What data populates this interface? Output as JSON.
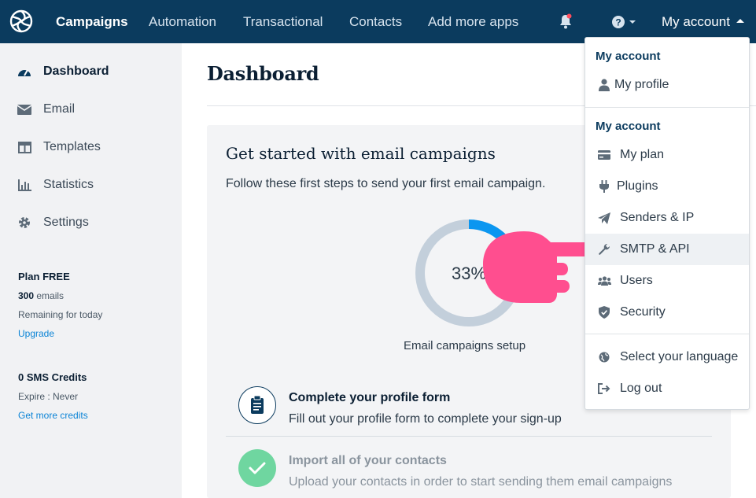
{
  "nav": {
    "items": [
      "Campaigns",
      "Automation",
      "Transactional",
      "Contacts",
      "Add more apps"
    ],
    "account_label": "My account"
  },
  "sidebar": {
    "items": [
      {
        "label": "Dashboard",
        "icon": "dashboard-icon"
      },
      {
        "label": "Email",
        "icon": "envelope-icon"
      },
      {
        "label": "Templates",
        "icon": "templates-icon"
      },
      {
        "label": "Statistics",
        "icon": "bar-chart-icon"
      },
      {
        "label": "Settings",
        "icon": "gear-icon"
      }
    ],
    "plan": {
      "title": "Plan FREE",
      "emails_count": "300",
      "emails_unit": "emails",
      "remaining": "Remaining for today",
      "upgrade": "Upgrade"
    },
    "sms": {
      "title": "0 SMS Credits",
      "expire": "Expire : Never",
      "more": "Get more credits"
    }
  },
  "main": {
    "title": "Dashboard",
    "panel": {
      "title": "Get started with email campaigns",
      "subtitle": "Follow these first steps to send your first email campaign.",
      "progress_text": "33%",
      "progress_value": 0.33,
      "progress_label": "Email campaigns setup",
      "steps": [
        {
          "title": "Complete your profile form",
          "desc": "Fill out your profile form to complete your sign-up",
          "icon": "clipboard-icon"
        },
        {
          "title": "Import all of your contacts",
          "desc": "Upload your contacts in order to start sending them email campaigns",
          "icon": "check-icon"
        }
      ]
    }
  },
  "dropdown": {
    "section1_header": "My account",
    "profile": "My profile",
    "section2_header": "My account",
    "items": [
      {
        "label": "My plan",
        "icon": "credit-card-icon"
      },
      {
        "label": "Plugins",
        "icon": "plug-icon"
      },
      {
        "label": "Senders & IP",
        "icon": "paper-plane-icon"
      },
      {
        "label": "SMTP & API",
        "icon": "wrench-icon"
      },
      {
        "label": "Users",
        "icon": "users-icon"
      },
      {
        "label": "Security",
        "icon": "shield-icon"
      }
    ],
    "language": "Select your language",
    "logout": "Log out"
  },
  "colors": {
    "nav_bg": "#0b3b5e",
    "ring_track": "#c3cfdb",
    "ring_progress": "#0b96f0",
    "pointer_hand": "#ff4e8f",
    "success": "#6fd6a0"
  }
}
